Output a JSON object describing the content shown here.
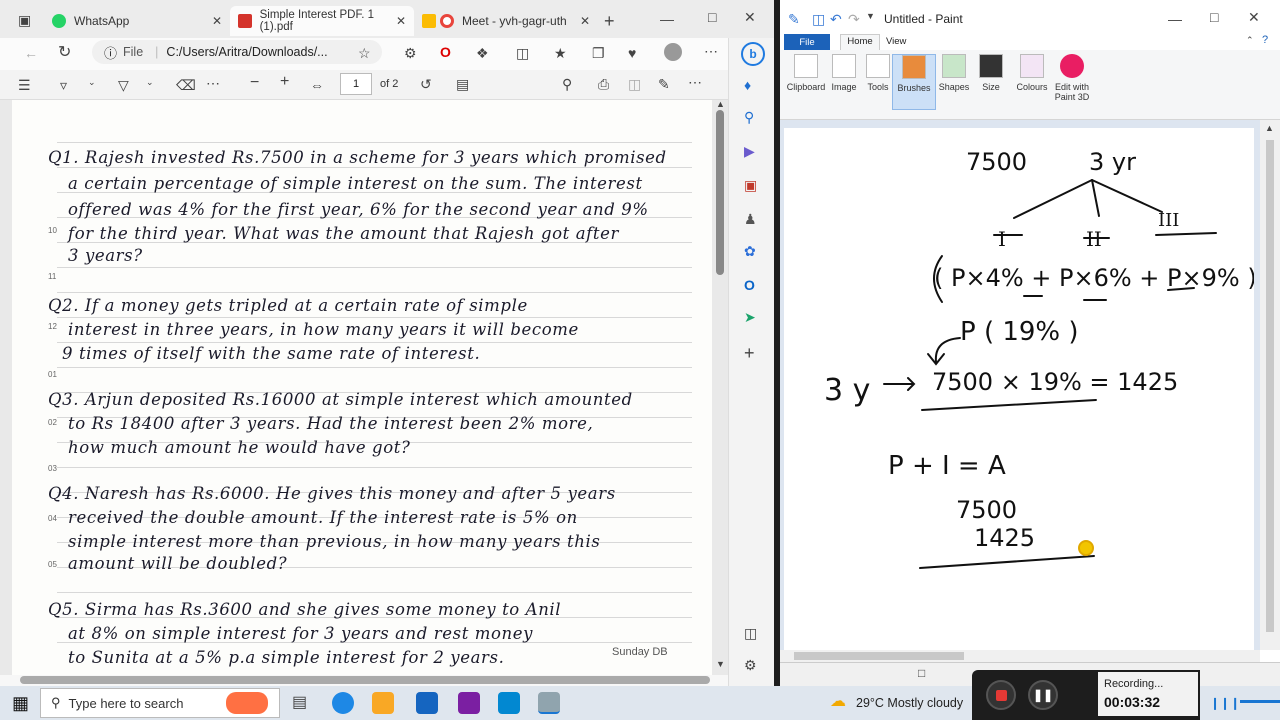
{
  "edge": {
    "tabs": [
      {
        "label": "WhatsApp",
        "color": "#25d366"
      },
      {
        "label": "Simple Interest PDF. 1 (1).pdf",
        "color": "#d4332b"
      },
      {
        "label": "Meet - yvh-gagr-uth",
        "color": "#e8453c"
      }
    ],
    "url_prefix": "File",
    "url": "C:/Users/Aritra/Downloads/...",
    "pdf_page": "1",
    "pdf_of": "of 2",
    "zoom_minus": "−",
    "zoom_plus": "+"
  },
  "pdf": {
    "margin_numbers": [
      "10",
      "11",
      "12",
      "01",
      "02",
      "03",
      "04",
      "05"
    ],
    "lines": [
      "Q1. Rajesh invested Rs.7500 in a scheme for 3 years which promised",
      "a certain percentage of simple interest on the sum. The interest",
      "offered was 4% for the first year, 6% for the second year and 9%",
      "for the third year. What was the amount that Rajesh got after",
      "3 years?",
      "Q2. If a money gets tripled at a certain rate of simple",
      "interest in three years, in how many years it will become",
      "9 times of itself with the same rate of interest.",
      "Q3. Arjun deposited Rs.16000 at simple interest which amounted",
      "to Rs 18400 after 3 years. Had the interest been 2% more,",
      "how much amount he would have got?",
      "Q4. Naresh has Rs.6000. He gives this money and after 5 years",
      "received the double amount. If the interest rate is 5% on",
      "simple interest more than previous, in how many years this",
      "amount will be doubled?",
      "Q5. Sirma has Rs.3600 and she gives some money to Anil",
      "at 8% on simple interest for 3 years and rest money",
      "to Sunita at a 5% p.a simple interest for 2 years."
    ],
    "watermark": "Sunday DB"
  },
  "paint": {
    "title": "Untitled - Paint",
    "menu": {
      "file": "File",
      "home": "Home",
      "view": "View"
    },
    "ribbon": [
      "Clipboard",
      "Image",
      "Tools",
      "Brushes",
      "Shapes",
      "Size",
      "Colours",
      "Edit with Paint 3D"
    ],
    "notes": {
      "principal": "7500",
      "years": "3 yr",
      "y1": "I",
      "y2": "II",
      "y3": "III",
      "formula": "( P×4% + P×6% + P×9% )",
      "p19": "P ( 19% )",
      "threey": "3 y",
      "calc": "7500 × 19% = 1425",
      "pia": "P + I = A",
      "add1": "7500",
      "add2": "1425"
    }
  },
  "taskbar": {
    "search_placeholder": "Type here to search",
    "weather": "29°C  Mostly cloudy",
    "rec_label": "Recording...",
    "rec_time": "00:03:32"
  }
}
